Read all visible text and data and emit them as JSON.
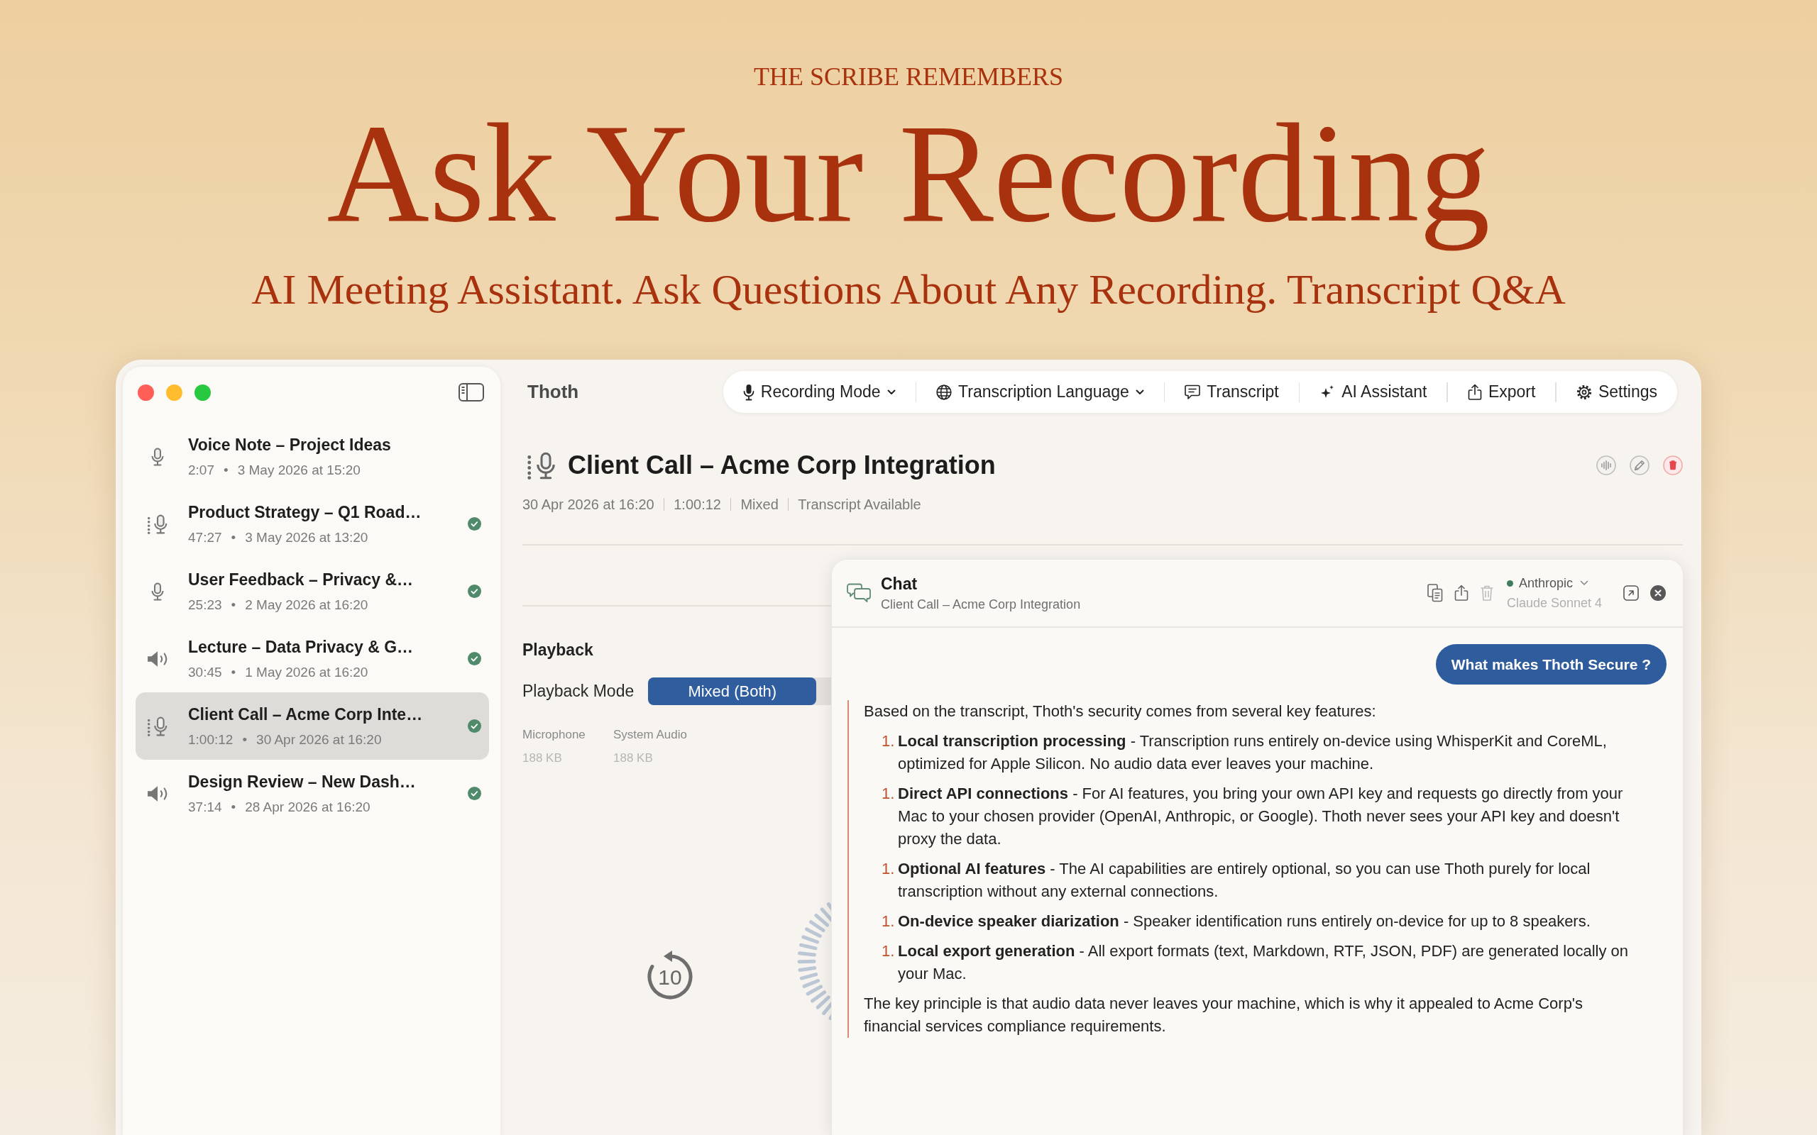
{
  "hero": {
    "kicker": "THE SCRIBE REMEMBERS",
    "title": "Ask Your Recording",
    "subtitle": "AI Meeting Assistant. Ask Questions About Any Recording. Transcript Q&A"
  },
  "window": {
    "app_name": "Thoth"
  },
  "sidebar": {
    "recordings": [
      {
        "title": "Voice Note – Project Ideas",
        "duration": "2:07",
        "separator": "•",
        "date": "3 May 2026 at 15:20",
        "kind": "microphone",
        "transcribed": false,
        "selected": false
      },
      {
        "title": "Product Strategy – Q1 Road…",
        "duration": "47:27",
        "separator": "•",
        "date": "3 May 2026 at 13:20",
        "kind": "mixed",
        "transcribed": true,
        "selected": false
      },
      {
        "title": "User Feedback – Privacy &…",
        "duration": "25:23",
        "separator": "•",
        "date": "2 May 2026 at 16:20",
        "kind": "microphone",
        "transcribed": true,
        "selected": false
      },
      {
        "title": "Lecture – Data Privacy & G…",
        "duration": "30:45",
        "separator": "•",
        "date": "1 May 2026 at 16:20",
        "kind": "system",
        "transcribed": true,
        "selected": false
      },
      {
        "title": "Client Call – Acme Corp Inte…",
        "duration": "1:00:12",
        "separator": "•",
        "date": "30 Apr 2026 at 16:20",
        "kind": "mixed",
        "transcribed": true,
        "selected": true
      },
      {
        "title": "Design Review – New Dash…",
        "duration": "37:14",
        "separator": "•",
        "date": "28 Apr 2026 at 16:20",
        "kind": "system",
        "transcribed": true,
        "selected": false
      }
    ]
  },
  "toolbar": {
    "items": [
      {
        "label": "Recording Mode",
        "kind": "mode",
        "dropdown": true
      },
      {
        "label": "Transcription Language",
        "kind": "language",
        "dropdown": true
      },
      {
        "label": "Transcript",
        "kind": "transcript",
        "dropdown": false
      },
      {
        "label": "AI Assistant",
        "kind": "assistant",
        "dropdown": false
      },
      {
        "label": "Export",
        "kind": "export",
        "dropdown": false
      },
      {
        "label": "Settings",
        "kind": "settings",
        "dropdown": false
      }
    ]
  },
  "recording": {
    "title": "Client Call – Acme Corp Integration",
    "kind": "mixed",
    "meta": [
      "30 Apr 2026 at 16:20",
      "1:00:12",
      "Mixed",
      "Transcript Available"
    ]
  },
  "playback": {
    "heading": "Playback",
    "mode_label": "Playback Mode",
    "modes": [
      {
        "label": "Mixed (Both)",
        "selected": true
      }
    ],
    "tracks": [
      {
        "name": "Microphone",
        "size": "188 KB"
      },
      {
        "name": "System Audio",
        "size": "188 KB"
      }
    ],
    "skip_back": "10"
  },
  "chat": {
    "title": "Chat",
    "subtitle": "Client Call – Acme Corp Integration",
    "provider": {
      "name": "Anthropic",
      "model": "Claude Sonnet 4",
      "connected": true
    },
    "messages": [
      {
        "kind": "user",
        "text": "What makes Thoth Secure ?"
      },
      {
        "kind": "assistant",
        "intro": "Based on the transcript, Thoth's security comes from several key features:",
        "items": [
          {
            "number": "1.",
            "text": "**Local transcription processing** - Transcription runs entirely on-device using WhisperKit and CoreML, optimized for Apple Silicon. No audio data ever leaves your machine."
          },
          {
            "number": "1.",
            "text": "**Direct API connections** - For AI features, you bring your own API key and requests go directly from your Mac to your chosen provider (OpenAI, Anthropic, or Google). Thoth never sees your API key and doesn't proxy the data."
          },
          {
            "number": "1.",
            "text": "**Optional AI features** - The AI capabilities are entirely optional, so you can use Thoth purely for local transcription without any external connections."
          },
          {
            "number": "1.",
            "text": "**On-device speaker diarization** - Speaker identification runs entirely on-device for up to 8 speakers."
          },
          {
            "number": "1.",
            "text": "**Local export generation** - All export formats (text, Markdown, RTF, JSON, PDF) are generated locally on your Mac."
          }
        ],
        "outro": "The key principle is that audio data never leaves your machine, which is why it appealed to Acme Corp's financial services compliance requirements."
      }
    ]
  }
}
